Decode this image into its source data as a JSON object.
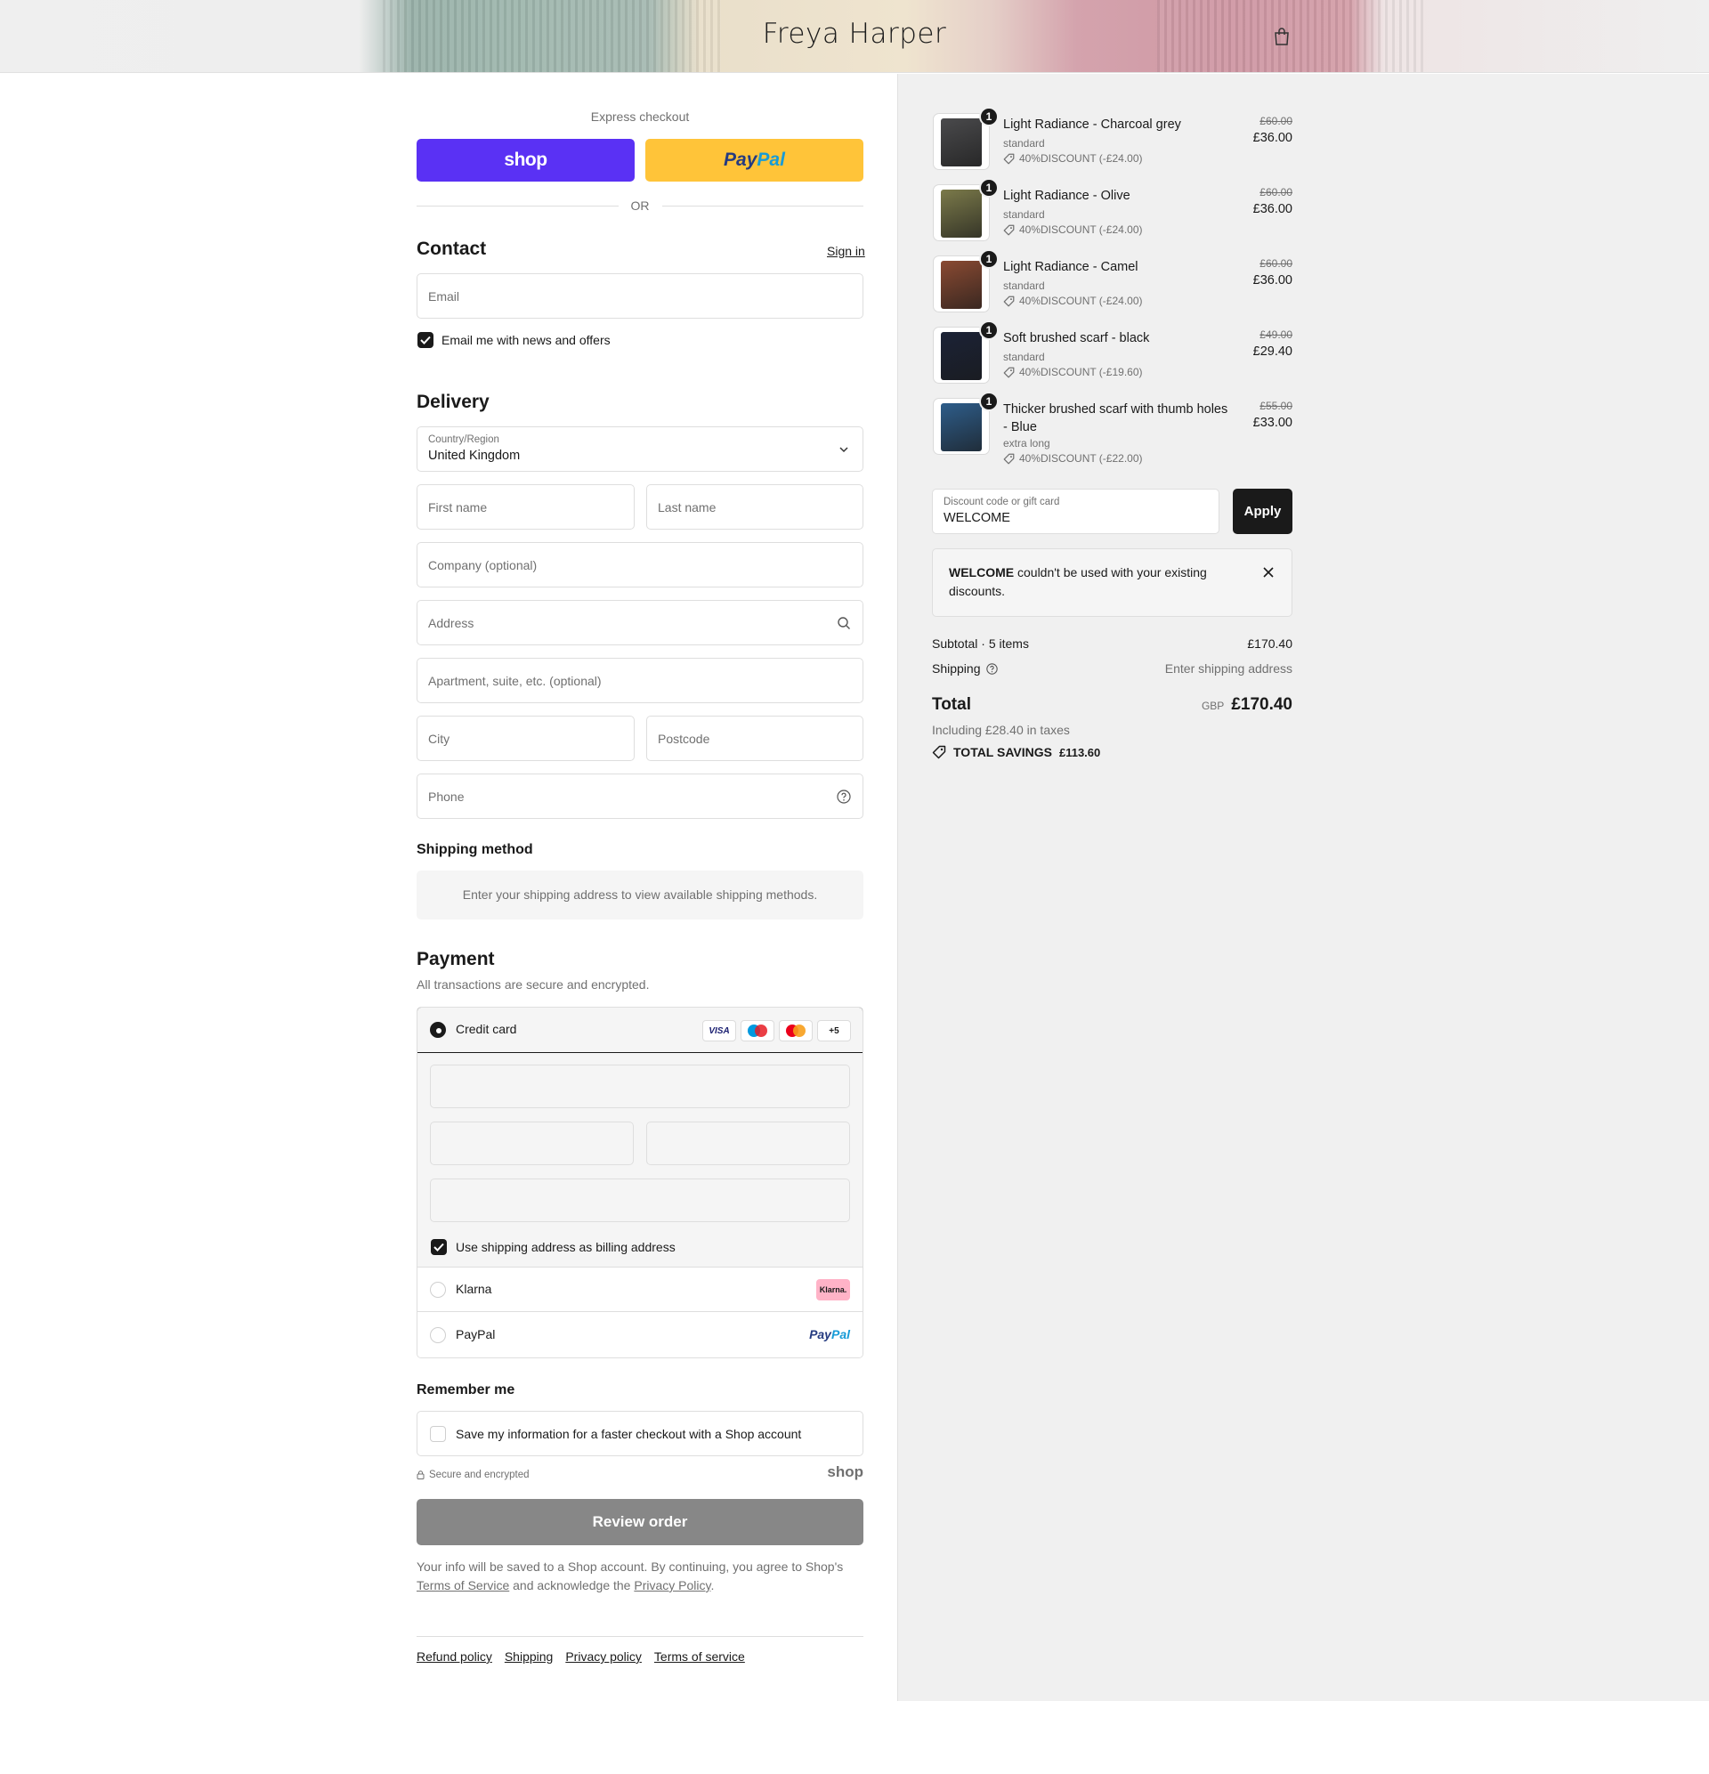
{
  "header": {
    "brand": "Freya Harper",
    "cart_icon": "shopping-bag-icon"
  },
  "express": {
    "label": "Express checkout",
    "shop_label": "shop",
    "paypal_label_1": "Pay",
    "paypal_label_2": "Pal",
    "or": "OR"
  },
  "contact": {
    "title": "Contact",
    "sign_in": "Sign in",
    "email_placeholder": "Email",
    "news_label": "Email me with news and offers",
    "news_checked": true
  },
  "delivery": {
    "title": "Delivery",
    "country_label": "Country/Region",
    "country_value": "United Kingdom",
    "first_name": "First name",
    "last_name": "Last name",
    "company": "Company (optional)",
    "address": "Address",
    "apartment": "Apartment, suite, etc. (optional)",
    "city": "City",
    "postcode": "Postcode",
    "phone": "Phone"
  },
  "shipping_method": {
    "title": "Shipping method",
    "message": "Enter your shipping address to view available shipping methods."
  },
  "payment": {
    "title": "Payment",
    "subtitle": "All transactions are secure and encrypted.",
    "credit_card": "Credit card",
    "cards": [
      "VISA",
      "maestro",
      "mastercard",
      "+5"
    ],
    "billing_label": "Use shipping address as billing address",
    "billing_checked": true,
    "klarna": "Klarna",
    "klarna_badge": "Klarna.",
    "paypal": "PayPal",
    "paypal_badge_1": "Pay",
    "paypal_badge_2": "Pal"
  },
  "remember": {
    "title": "Remember me",
    "save_label": "Save my information for a faster checkout with a Shop account",
    "secure": "Secure and encrypted",
    "shop_logo": "shop"
  },
  "review": {
    "button": "Review order",
    "legal_1": "Your info will be saved to a Shop account. By continuing, you agree to Shop's",
    "terms": "Terms of Service",
    "legal_2": "and acknowledge the",
    "privacy": "Privacy Policy",
    "legal_3": "."
  },
  "footer": {
    "links": [
      "Refund policy",
      "Shipping",
      "Privacy policy",
      "Terms of service"
    ]
  },
  "order": {
    "items": [
      {
        "name": "Light Radiance - Charcoal grey",
        "variant": "standard",
        "discount": "40%DISCOUNT (-£24.00)",
        "old_price": "£60.00",
        "price": "£36.00",
        "qty": "1",
        "color": "#4a4a4c"
      },
      {
        "name": "Light Radiance - Olive",
        "variant": "standard",
        "discount": "40%DISCOUNT (-£24.00)",
        "old_price": "£60.00",
        "price": "£36.00",
        "qty": "1",
        "color": "#7b7a4a"
      },
      {
        "name": "Light Radiance - Camel",
        "variant": "standard",
        "discount": "40%DISCOUNT (-£24.00)",
        "old_price": "£60.00",
        "price": "£36.00",
        "qty": "1",
        "color": "#8a4a32"
      },
      {
        "name": "Soft brushed scarf - black",
        "variant": "standard",
        "discount": "40%DISCOUNT (-£19.60)",
        "old_price": "£49.00",
        "price": "£29.40",
        "qty": "1",
        "color": "#1b2236"
      },
      {
        "name": "Thicker brushed scarf with thumb holes - Blue",
        "variant": "extra long",
        "discount": "40%DISCOUNT (-£22.00)",
        "old_price": "£55.00",
        "price": "£33.00",
        "qty": "1",
        "color": "#2e5d8a"
      }
    ],
    "discount_label": "Discount code or gift card",
    "discount_value": "WELCOME",
    "apply": "Apply",
    "notice_bold": "WELCOME",
    "notice_text": "couldn't be used with your existing discounts.",
    "subtotal_label": "Subtotal · 5 items",
    "subtotal": "£170.40",
    "shipping_label": "Shipping",
    "shipping_value": "Enter shipping address",
    "total_label": "Total",
    "currency": "GBP",
    "total": "£170.40",
    "taxes": "Including £28.40 in taxes",
    "savings_label": "TOTAL SAVINGS",
    "savings": "£113.60"
  }
}
